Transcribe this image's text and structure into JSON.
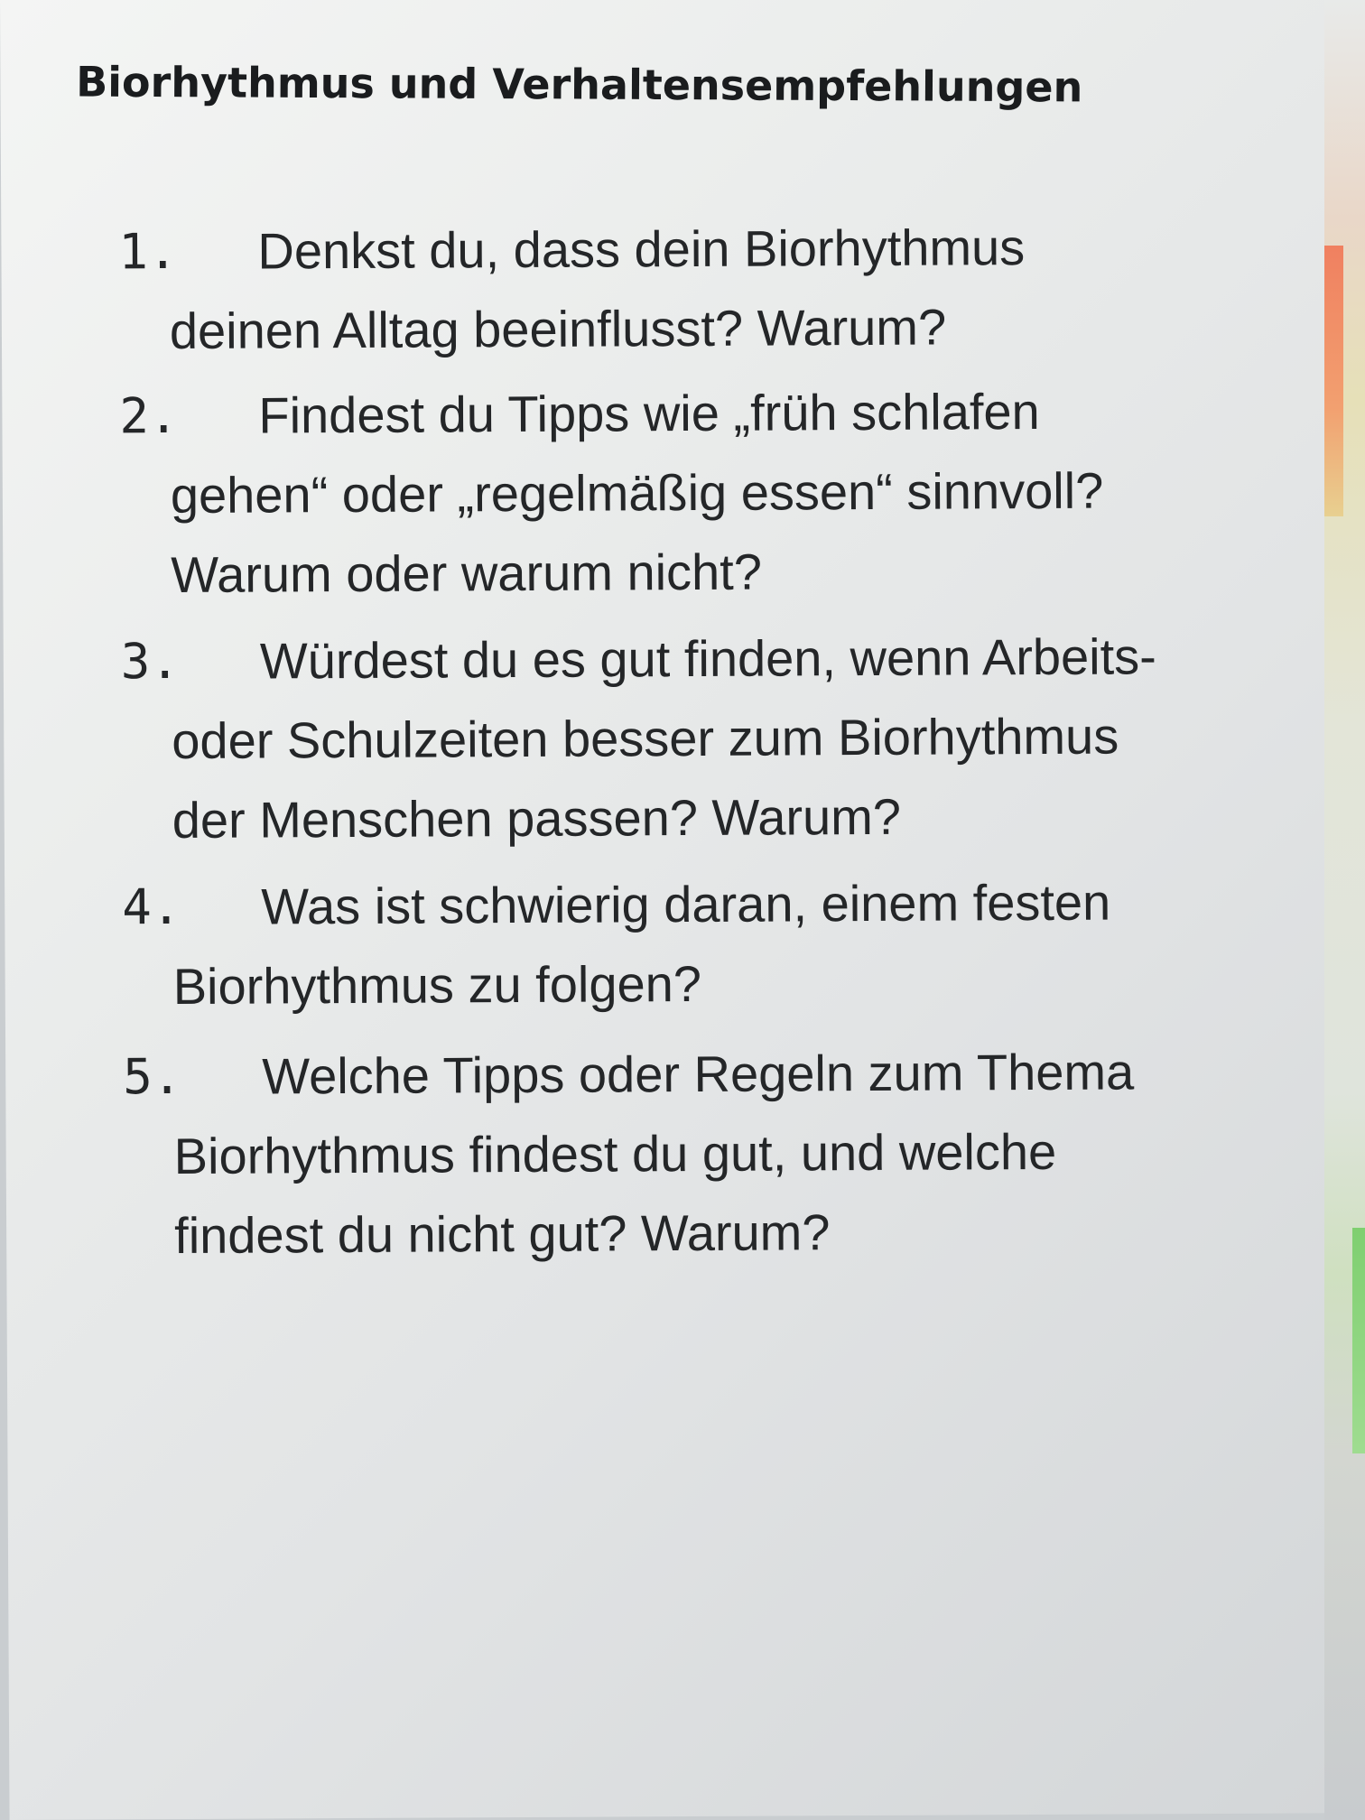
{
  "document": {
    "title": "Biorhythmus und Verhaltensempfehlungen",
    "questions": [
      {
        "number": "1.",
        "text": "Denkst du, dass dein Biorhythmus deinen Alltag beeinflusst? Warum?"
      },
      {
        "number": "2.",
        "text": "Findest du Tipps wie „früh schlafen gehen“ oder „regelmäßig essen“ sinnvoll? Warum oder warum nicht?"
      },
      {
        "number": "3.",
        "text": "Würdest du es gut finden, wenn Arbeits- oder Schulzeiten besser zum Biorhythmus der Menschen passen? Warum?"
      },
      {
        "number": "4.",
        "text": "Was ist schwierig daran, einem festen Biorhythmus zu folgen?"
      },
      {
        "number": "5.",
        "text": "Welche Tipps oder Regeln zum Thema Biorhythmus findest du gut, und welche findest du nicht gut? Warum?"
      }
    ]
  },
  "colors": {
    "paper": "#ebedec",
    "text": "#242628",
    "edge_orange": "#f08060",
    "edge_green": "#7fcf70"
  }
}
